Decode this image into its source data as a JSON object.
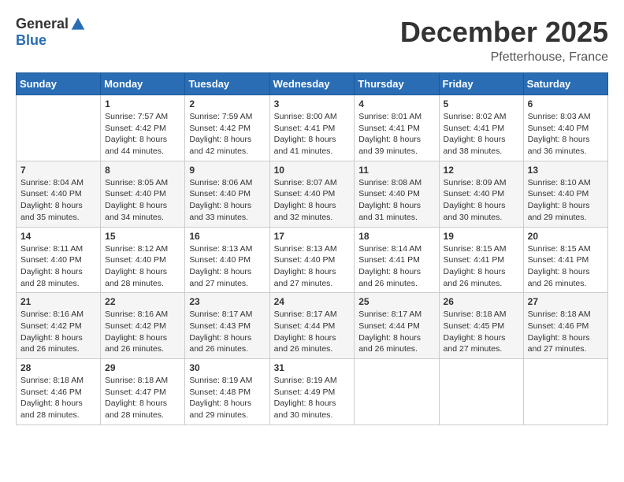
{
  "header": {
    "logo_general": "General",
    "logo_blue": "Blue",
    "month_title": "December 2025",
    "location": "Pfetterhouse, France"
  },
  "days_of_week": [
    "Sunday",
    "Monday",
    "Tuesday",
    "Wednesday",
    "Thursday",
    "Friday",
    "Saturday"
  ],
  "weeks": [
    [
      {
        "day": "",
        "content": ""
      },
      {
        "day": "1",
        "content": "Sunrise: 7:57 AM\nSunset: 4:42 PM\nDaylight: 8 hours\nand 44 minutes."
      },
      {
        "day": "2",
        "content": "Sunrise: 7:59 AM\nSunset: 4:42 PM\nDaylight: 8 hours\nand 42 minutes."
      },
      {
        "day": "3",
        "content": "Sunrise: 8:00 AM\nSunset: 4:41 PM\nDaylight: 8 hours\nand 41 minutes."
      },
      {
        "day": "4",
        "content": "Sunrise: 8:01 AM\nSunset: 4:41 PM\nDaylight: 8 hours\nand 39 minutes."
      },
      {
        "day": "5",
        "content": "Sunrise: 8:02 AM\nSunset: 4:41 PM\nDaylight: 8 hours\nand 38 minutes."
      },
      {
        "day": "6",
        "content": "Sunrise: 8:03 AM\nSunset: 4:40 PM\nDaylight: 8 hours\nand 36 minutes."
      }
    ],
    [
      {
        "day": "7",
        "content": "Sunrise: 8:04 AM\nSunset: 4:40 PM\nDaylight: 8 hours\nand 35 minutes."
      },
      {
        "day": "8",
        "content": "Sunrise: 8:05 AM\nSunset: 4:40 PM\nDaylight: 8 hours\nand 34 minutes."
      },
      {
        "day": "9",
        "content": "Sunrise: 8:06 AM\nSunset: 4:40 PM\nDaylight: 8 hours\nand 33 minutes."
      },
      {
        "day": "10",
        "content": "Sunrise: 8:07 AM\nSunset: 4:40 PM\nDaylight: 8 hours\nand 32 minutes."
      },
      {
        "day": "11",
        "content": "Sunrise: 8:08 AM\nSunset: 4:40 PM\nDaylight: 8 hours\nand 31 minutes."
      },
      {
        "day": "12",
        "content": "Sunrise: 8:09 AM\nSunset: 4:40 PM\nDaylight: 8 hours\nand 30 minutes."
      },
      {
        "day": "13",
        "content": "Sunrise: 8:10 AM\nSunset: 4:40 PM\nDaylight: 8 hours\nand 29 minutes."
      }
    ],
    [
      {
        "day": "14",
        "content": "Sunrise: 8:11 AM\nSunset: 4:40 PM\nDaylight: 8 hours\nand 28 minutes."
      },
      {
        "day": "15",
        "content": "Sunrise: 8:12 AM\nSunset: 4:40 PM\nDaylight: 8 hours\nand 28 minutes."
      },
      {
        "day": "16",
        "content": "Sunrise: 8:13 AM\nSunset: 4:40 PM\nDaylight: 8 hours\nand 27 minutes."
      },
      {
        "day": "17",
        "content": "Sunrise: 8:13 AM\nSunset: 4:40 PM\nDaylight: 8 hours\nand 27 minutes."
      },
      {
        "day": "18",
        "content": "Sunrise: 8:14 AM\nSunset: 4:41 PM\nDaylight: 8 hours\nand 26 minutes."
      },
      {
        "day": "19",
        "content": "Sunrise: 8:15 AM\nSunset: 4:41 PM\nDaylight: 8 hours\nand 26 minutes."
      },
      {
        "day": "20",
        "content": "Sunrise: 8:15 AM\nSunset: 4:41 PM\nDaylight: 8 hours\nand 26 minutes."
      }
    ],
    [
      {
        "day": "21",
        "content": "Sunrise: 8:16 AM\nSunset: 4:42 PM\nDaylight: 8 hours\nand 26 minutes."
      },
      {
        "day": "22",
        "content": "Sunrise: 8:16 AM\nSunset: 4:42 PM\nDaylight: 8 hours\nand 26 minutes."
      },
      {
        "day": "23",
        "content": "Sunrise: 8:17 AM\nSunset: 4:43 PM\nDaylight: 8 hours\nand 26 minutes."
      },
      {
        "day": "24",
        "content": "Sunrise: 8:17 AM\nSunset: 4:44 PM\nDaylight: 8 hours\nand 26 minutes."
      },
      {
        "day": "25",
        "content": "Sunrise: 8:17 AM\nSunset: 4:44 PM\nDaylight: 8 hours\nand 26 minutes."
      },
      {
        "day": "26",
        "content": "Sunrise: 8:18 AM\nSunset: 4:45 PM\nDaylight: 8 hours\nand 27 minutes."
      },
      {
        "day": "27",
        "content": "Sunrise: 8:18 AM\nSunset: 4:46 PM\nDaylight: 8 hours\nand 27 minutes."
      }
    ],
    [
      {
        "day": "28",
        "content": "Sunrise: 8:18 AM\nSunset: 4:46 PM\nDaylight: 8 hours\nand 28 minutes."
      },
      {
        "day": "29",
        "content": "Sunrise: 8:18 AM\nSunset: 4:47 PM\nDaylight: 8 hours\nand 28 minutes."
      },
      {
        "day": "30",
        "content": "Sunrise: 8:19 AM\nSunset: 4:48 PM\nDaylight: 8 hours\nand 29 minutes."
      },
      {
        "day": "31",
        "content": "Sunrise: 8:19 AM\nSunset: 4:49 PM\nDaylight: 8 hours\nand 30 minutes."
      },
      {
        "day": "",
        "content": ""
      },
      {
        "day": "",
        "content": ""
      },
      {
        "day": "",
        "content": ""
      }
    ]
  ]
}
